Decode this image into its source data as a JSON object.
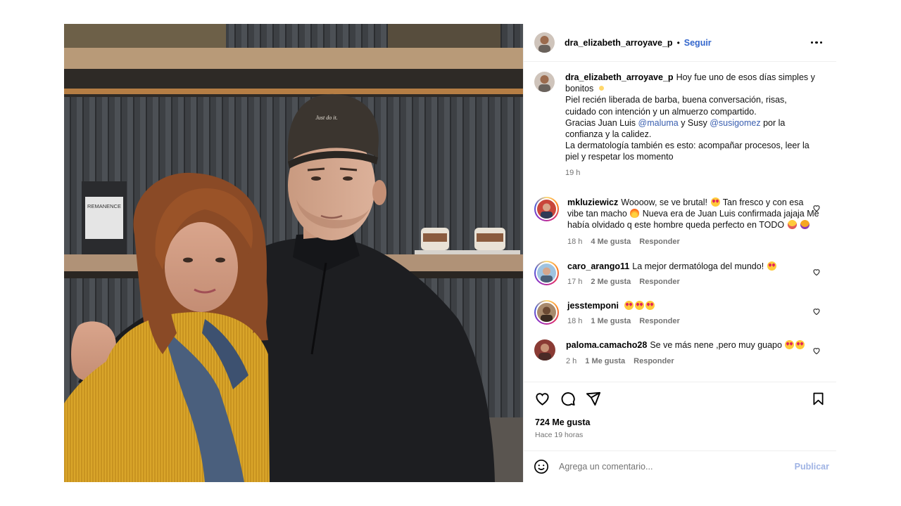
{
  "post": {
    "username": "dra_elizabeth_arroyave_p",
    "follow_label": "Seguir",
    "dot": "•",
    "more_icon": "more-options-icon",
    "caption": {
      "line1_text": "Hoy fue uno de esos días simples y bonitos",
      "line2": "Piel recién liberada de barba, buena conversación, risas, cuidado con intención y un almuerzo compartido.",
      "line3_a": "Gracias Juan Luis",
      "mention1": "@maluma",
      "line3_b": "y Susy",
      "mention2": "@susigomez",
      "line3_c": "por la confianza y la calidez.",
      "line4": "La dermatología también es esto: acompañar procesos, leer la piel y respetar los momento",
      "time": "19 h"
    },
    "photo": {
      "cap_text": "Just do it.",
      "bag_label": "REMANENCE"
    }
  },
  "comments": [
    {
      "username": "mkluziewicz",
      "text_a": "Woooow, se ve brutal!",
      "text_b": "Tan fresco y con esa vibe tan macho",
      "text_c": "Nueva era de Juan Luis confirmada jajaja Me había olvidado q este hombre queda perfecto en TODO",
      "time": "18 h",
      "likes": "4 Me gusta",
      "reply": "Responder",
      "avatar_color": "#c9463b"
    },
    {
      "username": "caro_arango11",
      "text_a": "La mejor dermatóloga del mundo!",
      "time": "17 h",
      "likes": "2 Me gusta",
      "reply": "Responder",
      "avatar_color": "#5f8fb8"
    },
    {
      "username": "jesstemponi",
      "time": "18 h",
      "likes": "1 Me gusta",
      "reply": "Responder",
      "avatar_color": "#6b4a33"
    },
    {
      "username": "paloma.camacho28",
      "text_a": "Se ve más nene ,pero muy guapo",
      "time": "2 h",
      "likes": "1 Me gusta",
      "reply": "Responder",
      "avatar_color": "#8a3b34"
    }
  ],
  "actions": {
    "like_icon": "heart-icon",
    "comment_icon": "comment-icon",
    "share_icon": "share-icon",
    "save_icon": "bookmark-icon",
    "likes_count": "724 Me gusta",
    "posted_ago": "Hace 19 horas"
  },
  "composer": {
    "placeholder": "Agrega un comentario...",
    "publish_label": "Publicar",
    "emoji_icon": "emoji-icon"
  },
  "colors": {
    "link_blue": "#3366cc",
    "muted": "#737373",
    "publish_disabled": "#9fb3e4",
    "divider": "#efefef"
  }
}
